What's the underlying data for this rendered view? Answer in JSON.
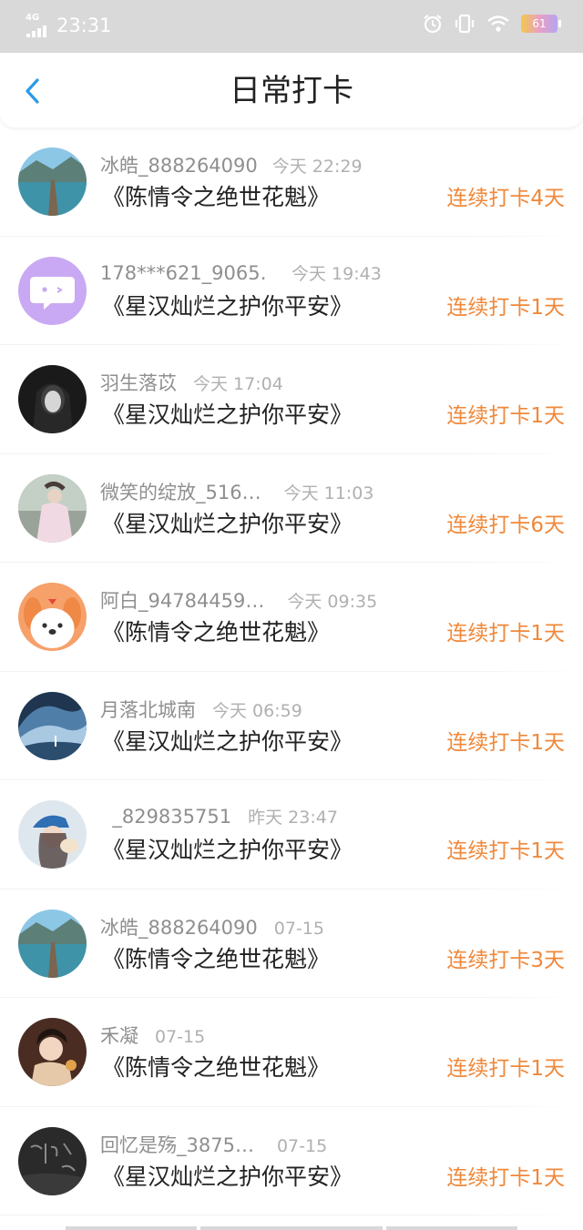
{
  "status_bar": {
    "network": "4G",
    "time": "23:31",
    "battery": "61"
  },
  "header": {
    "title": "日常打卡"
  },
  "colors": {
    "accent_blue": "#2a9ae8",
    "streak_orange": "#f0883a"
  },
  "checkins": [
    {
      "username": "冰皓_888264090",
      "date": "今天 22:29",
      "book": "《陈情令之绝世花魁》",
      "streak": "连续打卡4天",
      "avatar": "avatar-pier"
    },
    {
      "username": "178***621_9065…",
      "date": "今天 19:43",
      "book": "《星汉灿烂之护你平安》",
      "streak": "连续打卡1天",
      "avatar": "avatar-chat-purple"
    },
    {
      "username": "羽生落苡",
      "date": "今天 17:04",
      "book": "《星汉灿烂之护你平安》",
      "streak": "连续打卡1天",
      "avatar": "avatar-dark-portrait"
    },
    {
      "username": "微笑的绽放_516…",
      "date": "今天 11:03",
      "book": "《星汉灿烂之护你平安》",
      "streak": "连续打卡6天",
      "avatar": "avatar-costume"
    },
    {
      "username": "阿白_94784459…",
      "date": "今天 09:35",
      "book": "《陈情令之绝世花魁》",
      "streak": "连续打卡1天",
      "avatar": "avatar-cartoon-dog"
    },
    {
      "username": "月落北城南",
      "date": "今天 06:59",
      "book": "《星汉灿烂之护你平安》",
      "streak": "连续打卡1天",
      "avatar": "avatar-wave"
    },
    {
      "username": "  _829835751",
      "date": "昨天 23:47",
      "book": "《星汉灿烂之护你平安》",
      "streak": "连续打卡1天",
      "avatar": "avatar-girl-cap"
    },
    {
      "username": "冰皓_888264090",
      "date": "07-15",
      "book": "《陈情令之绝世花魁》",
      "streak": "连续打卡3天",
      "avatar": "avatar-pier"
    },
    {
      "username": "禾凝",
      "date": "07-15",
      "book": "《陈情令之绝世花魁》",
      "streak": "连续打卡1天",
      "avatar": "avatar-portrait-warm"
    },
    {
      "username": "回忆是殇_3875…",
      "date": "07-15",
      "book": "《星汉灿烂之护你平安》",
      "streak": "连续打卡1天",
      "avatar": "avatar-dark-calligraphy"
    }
  ]
}
